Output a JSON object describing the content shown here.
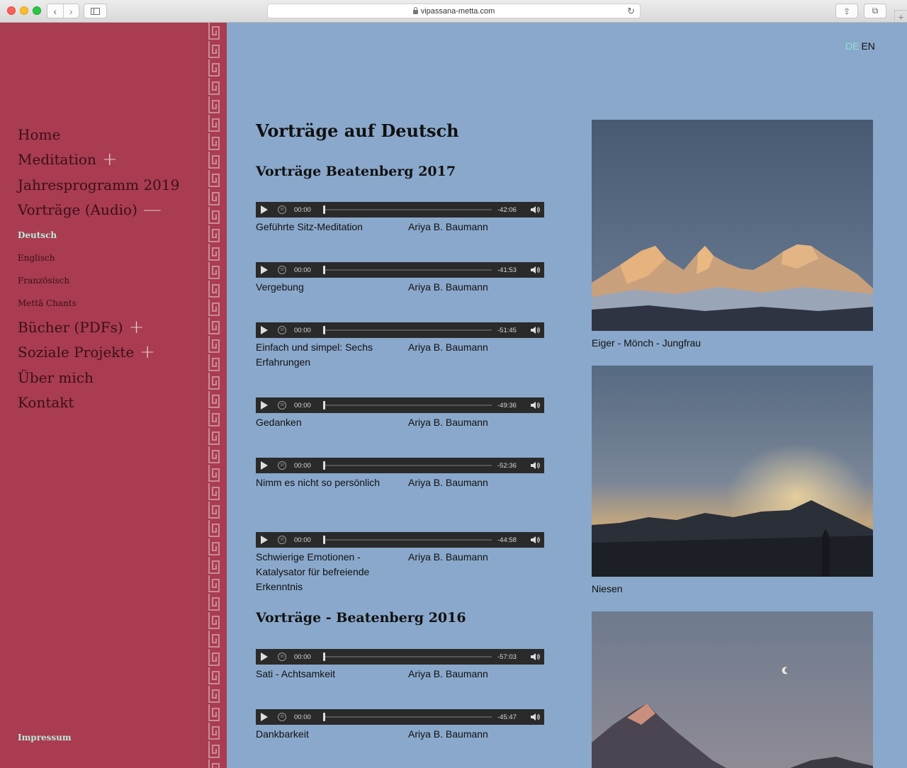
{
  "browser": {
    "url": "vipassana-metta.com",
    "back_glyph": "‹",
    "forward_glyph": "›",
    "reload_glyph": "↻",
    "share_glyph": "⇪",
    "tabs_glyph": "⧉",
    "newtab_glyph": "+"
  },
  "sidebar": {
    "nav": {
      "home": "Home",
      "meditation": "Meditation",
      "jahresprogramm": "Jahresprogramm 2019",
      "vortraege": "Vorträge (Audio)",
      "sub_deutsch": "Deutsch",
      "sub_englisch": "Englisch",
      "sub_franz": "Französisch",
      "sub_chants": "Mettā Chants",
      "buecher": "Bücher (PDFs)",
      "soziale": "Soziale Projekte",
      "ueber": "Über mich",
      "kontakt": "Kontakt"
    },
    "expand_glyph": "+",
    "collapse_glyph": "—",
    "impressum": "Impressum",
    "colors": {
      "background": "#a93c51",
      "accent": "#b9ebdc"
    }
  },
  "lang": {
    "de": "DE",
    "en": "EN"
  },
  "main": {
    "title": "Vorträge auf Deutsch",
    "section_2017": "Vorträge Beatenberg 2017",
    "section_2016": "Vorträge - Beatenberg 2016",
    "player_current": "00:00",
    "rewind_label": "30",
    "tracks": [
      {
        "title": "Geführte Sitz-Meditation",
        "author": "Ariya B. Baumann",
        "remaining": "-42:06"
      },
      {
        "title": "Vergebung",
        "author": "Ariya B. Baumann",
        "remaining": "-41:53"
      },
      {
        "title": "Einfach und simpel: Sechs Erfahrungen",
        "author": "Ariya B. Baumann",
        "remaining": "-51:45"
      },
      {
        "title": "Gedanken",
        "author": "Ariya B. Baumann",
        "remaining": "-49:36"
      },
      {
        "title": "Nimm es nicht so persönlich",
        "author": "Ariya B. Baumann",
        "remaining": "-52:36"
      },
      {
        "title": "Schwierige Emotionen - Katalysator für befreiende Erkenntnis",
        "author": "Ariya B. Baumann",
        "remaining": "-44:58"
      },
      {
        "title": "Sati - Achtsamkeit",
        "author": "Ariya B. Baumann",
        "remaining": "-57:03"
      },
      {
        "title": "Dankbarkeit",
        "author": "Ariya B. Baumann",
        "remaining": "-45:47"
      }
    ]
  },
  "photos": [
    {
      "caption": "Eiger - Mönch - Jungfrau"
    },
    {
      "caption": "Niesen"
    },
    {
      "caption": ""
    }
  ]
}
